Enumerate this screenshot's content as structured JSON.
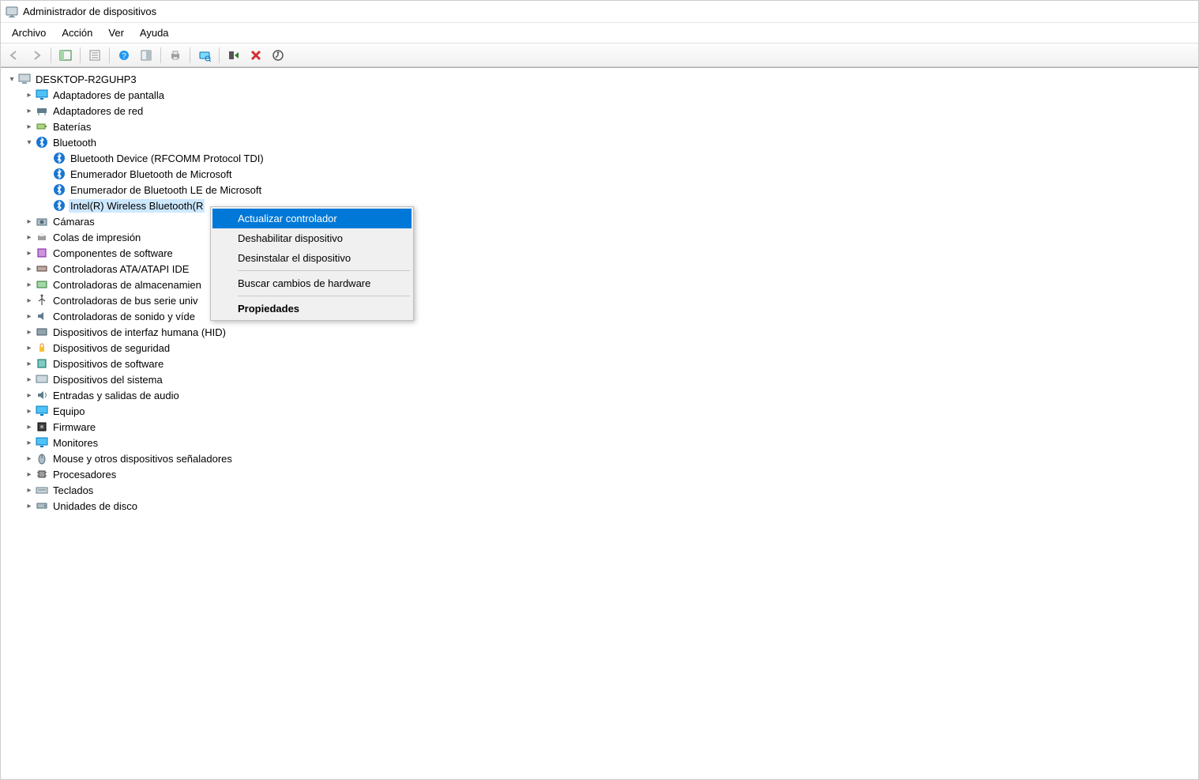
{
  "window": {
    "title": "Administrador de dispositivos"
  },
  "menu": {
    "file": "Archivo",
    "action": "Acción",
    "view": "Ver",
    "help": "Ayuda"
  },
  "tree": {
    "root": "DESKTOP-R2GUHP3",
    "categories": {
      "display_adapters": "Adaptadores de pantalla",
      "network_adapters": "Adaptadores de red",
      "batteries": "Baterías",
      "bluetooth": "Bluetooth",
      "cameras": "Cámaras",
      "print_queues": "Colas de impresión",
      "software_components": "Componentes de software",
      "ide_controllers": "Controladoras ATA/ATAPI IDE",
      "storage_controllers": "Controladoras de almacenamien",
      "usb_controllers": "Controladoras de bus serie univ",
      "sound_controllers": "Controladoras de sonido y víde",
      "hid": "Dispositivos de interfaz humana (HID)",
      "security_devices": "Dispositivos de seguridad",
      "software_devices": "Dispositivos de software",
      "system_devices": "Dispositivos del sistema",
      "audio_io": "Entradas y salidas de audio",
      "computer": "Equipo",
      "firmware": "Firmware",
      "monitors": "Monitores",
      "mouse": "Mouse y otros dispositivos señaladores",
      "processors": "Procesadores",
      "keyboards": "Teclados",
      "disk_drives": "Unidades de disco"
    },
    "bluetooth_children": {
      "rfcomm": "Bluetooth Device (RFCOMM Protocol TDI)",
      "ms_enum": "Enumerador Bluetooth de Microsoft",
      "ms_le_enum": "Enumerador de Bluetooth LE de Microsoft",
      "intel": "Intel(R) Wireless Bluetooth(R"
    }
  },
  "context_menu": {
    "update_driver": "Actualizar controlador",
    "disable": "Deshabilitar dispositivo",
    "uninstall": "Desinstalar el dispositivo",
    "scan": "Buscar cambios de hardware",
    "properties": "Propiedades"
  }
}
